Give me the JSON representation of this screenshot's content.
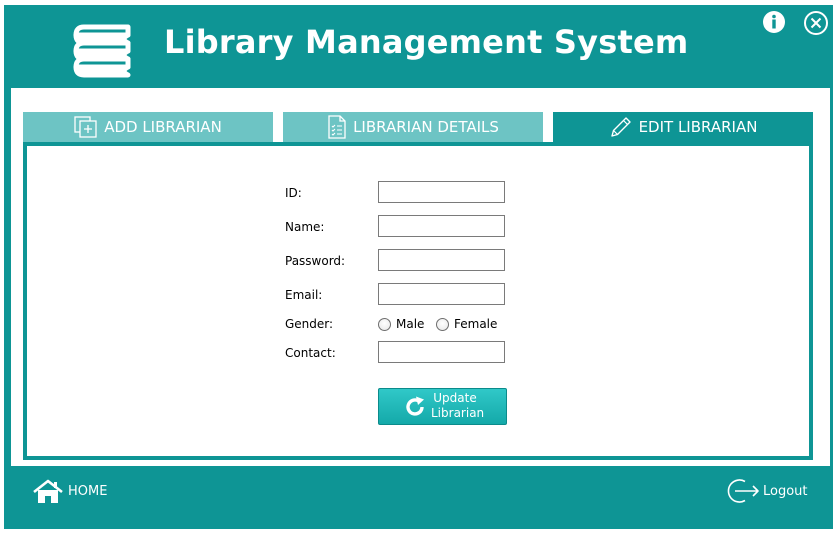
{
  "app": {
    "title": "Library Management System"
  },
  "tabs": [
    {
      "label": "ADD LIBRARIAN",
      "icon": "add-page-icon",
      "active": false
    },
    {
      "label": "LIBRARIAN DETAILS",
      "icon": "document-list-icon",
      "active": false
    },
    {
      "label": "EDIT LIBRARIAN",
      "icon": "pencil-icon",
      "active": true
    }
  ],
  "form": {
    "id_label": "ID:",
    "name_label": "Name:",
    "password_label": "Password:",
    "email_label": "Email:",
    "gender_label": "Gender:",
    "gender_options": [
      "Male",
      "Female"
    ],
    "contact_label": "Contact:",
    "id_value": "",
    "name_value": "",
    "password_value": "",
    "email_value": "",
    "contact_value": "",
    "update_line1": "Update",
    "update_line2": "Librarian"
  },
  "footer": {
    "home_label": "HOME",
    "logout_label": "Logout"
  },
  "colors": {
    "primary": "#0e9595",
    "tab_inactive": "#6dc4c4",
    "button": "#1fb6b6"
  }
}
